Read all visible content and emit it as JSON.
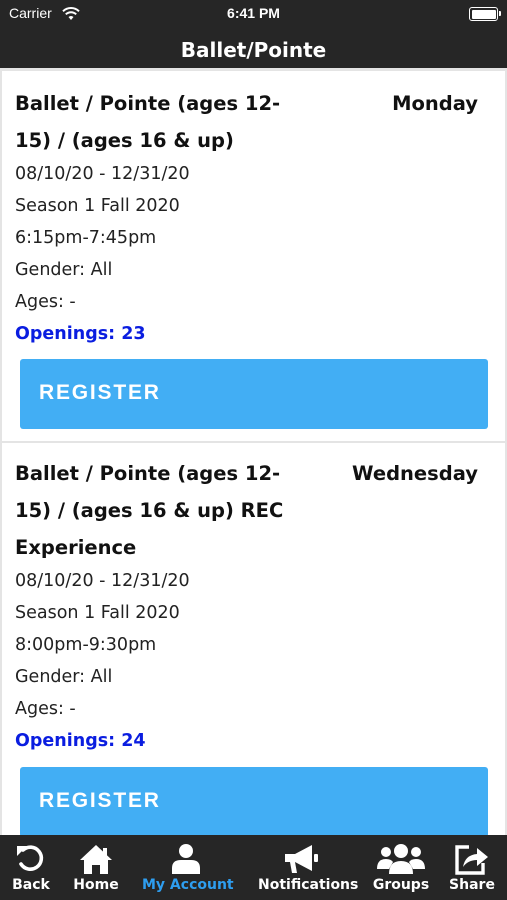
{
  "status_bar": {
    "carrier": "Carrier",
    "time": "6:41 PM"
  },
  "nav": {
    "title": "Ballet/Pointe"
  },
  "classes": [
    {
      "title": "Ballet / Pointe (ages 12-15) / (ages 16 & up)",
      "day": "Monday",
      "dates": "08/10/20 - 12/31/20",
      "season": "Season 1 Fall 2020",
      "time": "6:15pm-7:45pm",
      "gender": "Gender: All",
      "ages": "Ages: -",
      "openings": "Openings: 23",
      "button_label": "REGISTER"
    },
    {
      "title": "Ballet / Pointe (ages 12-15) / (ages 16 & up) REC Experience",
      "day": "Wednesday",
      "dates": "08/10/20 - 12/31/20",
      "season": "Season 1 Fall 2020",
      "time": "8:00pm-9:30pm",
      "gender": "Gender: All",
      "ages": "Ages: -",
      "openings": "Openings: 24",
      "button_label": "REGISTER"
    }
  ],
  "tab_bar": {
    "items": [
      {
        "label": "Back",
        "icon": "back-arrow-icon"
      },
      {
        "label": "Home",
        "icon": "home-icon"
      },
      {
        "label": "My Account",
        "icon": "user-icon",
        "active": true
      },
      {
        "label": "Notifications",
        "icon": "megaphone-icon"
      },
      {
        "label": "Groups",
        "icon": "group-icon"
      },
      {
        "label": "Share",
        "icon": "share-icon"
      }
    ]
  },
  "colors": {
    "bar_background": "#262626",
    "register_button": "#42aef4",
    "openings_text": "#0a1de0",
    "active_tab": "#2e9ef0"
  }
}
